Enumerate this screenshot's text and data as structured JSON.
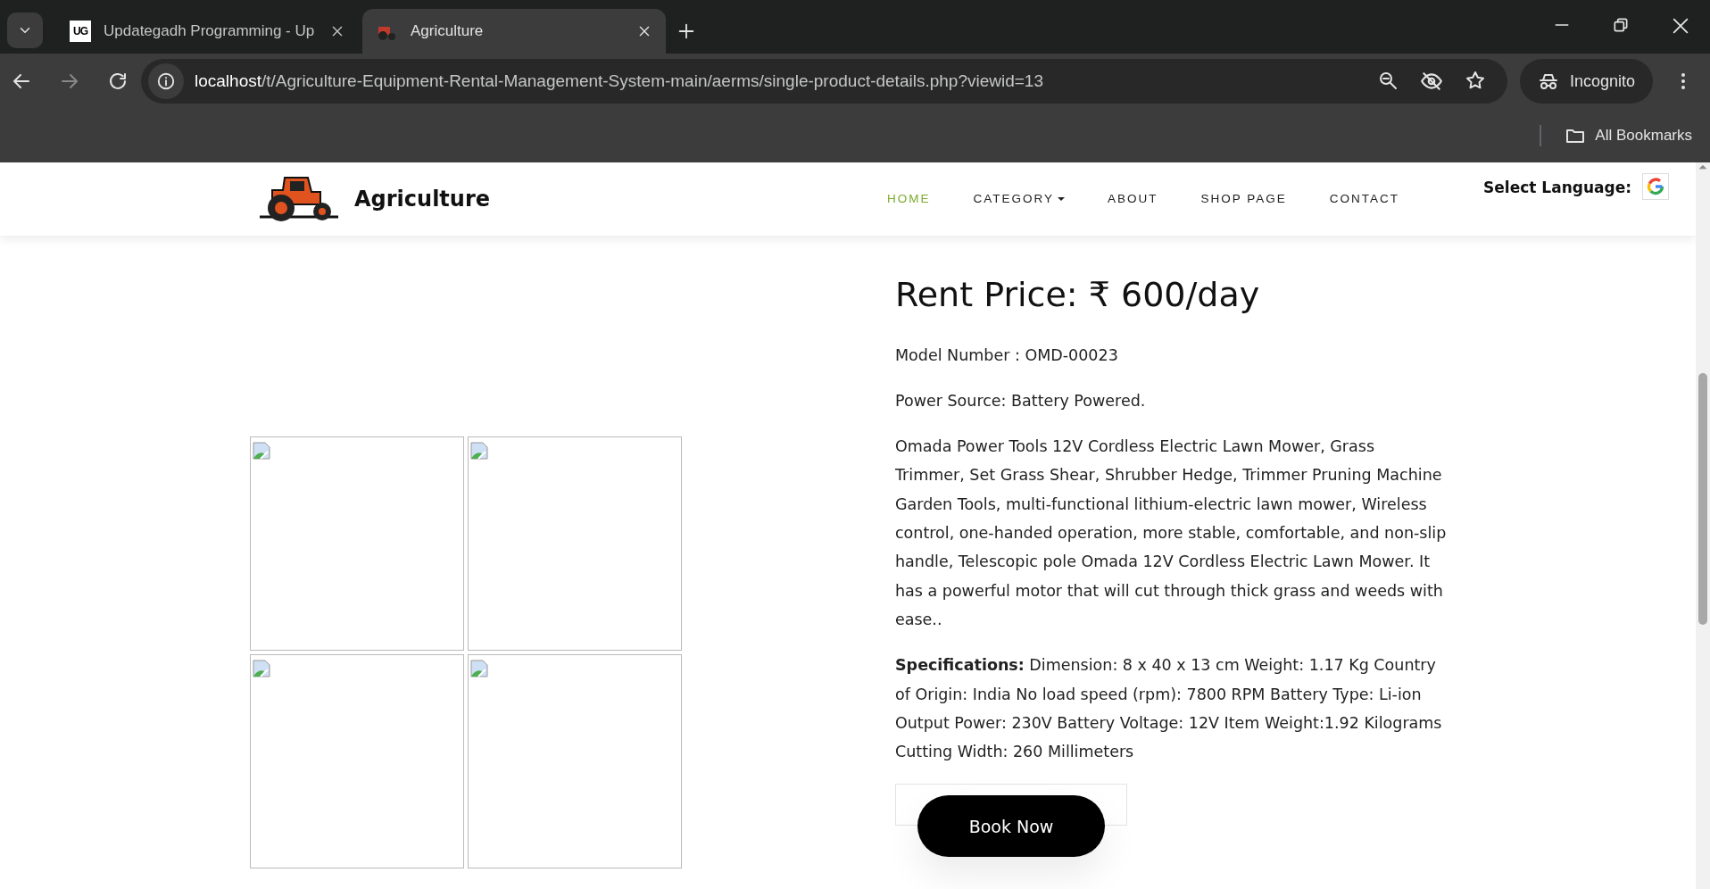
{
  "browser": {
    "tabs": [
      {
        "title": "Updategadh Programming - Up",
        "favicon": "UG",
        "selected": false
      },
      {
        "title": "Agriculture",
        "selected": true
      }
    ],
    "url_host": "localhost",
    "url_path": "/t/Agriculture-Equipment-Rental-Management-System-main/aerms/single-product-details.php?viewid=13",
    "profile": "Incognito",
    "bookmarks": "All Bookmarks"
  },
  "site": {
    "brand": "Agriculture",
    "nav": [
      {
        "label": "HOME",
        "selected": true,
        "dropdown": false
      },
      {
        "label": "CATEGORY",
        "selected": false,
        "dropdown": true
      },
      {
        "label": "ABOUT",
        "selected": false,
        "dropdown": false
      },
      {
        "label": "SHOP PAGE",
        "selected": false,
        "dropdown": false
      },
      {
        "label": "CONTACT",
        "selected": false,
        "dropdown": false
      }
    ],
    "language_label": "Select Language:"
  },
  "gallery": [
    {
      "kind": "broken"
    },
    {
      "kind": "broken"
    },
    {
      "kind": "broken"
    },
    {
      "kind": "broken"
    }
  ],
  "product": {
    "price": "Rent Price: ₹ 600/day",
    "model": "Model Number : OMD-00023",
    "power": "Power Source: Battery Powered.",
    "description": "Omada Power Tools 12V Cordless Electric Lawn Mower, Grass Trimmer, Set Grass Shear, Shrubber Hedge, Trimmer Pruning Machine Garden Tools, multi-functional lithium-electric lawn mower, Wireless control, one-handed operation, more stable, comfortable, and non-slip handle, Telescopic pole Omada 12V Cordless Electric Lawn Mower. It has a powerful motor that will cut through thick grass and weeds with ease..",
    "specifications": "**Specifications:** Dimension: 8 x 40 x 13 cm Weight: 1.17 Kg Country of Origin: India No load speed (rpm): 7800 RPM Battery Type: Li-ion Output Power: 230V Battery Voltage: 12V Item Weight:1.92 Kilograms Cutting Width: 260 Millimeters",
    "book_button": "Book Now"
  }
}
